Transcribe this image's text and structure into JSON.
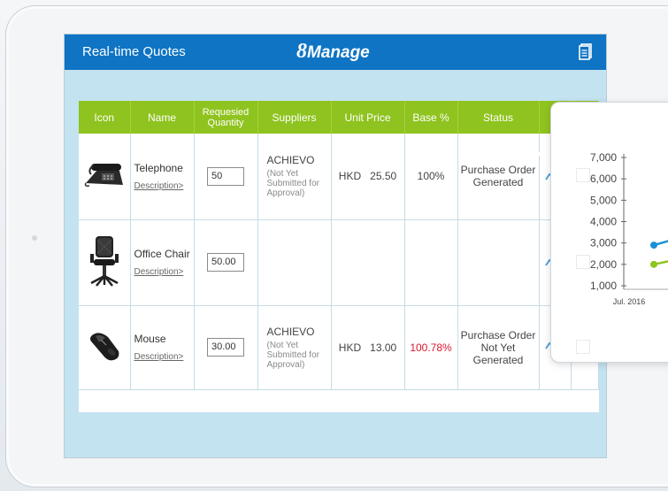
{
  "header": {
    "title": "Real-time Quotes",
    "logo_prefix": "8",
    "logo_text": "Manage"
  },
  "table": {
    "columns": [
      "Icon",
      "Name",
      "Requesied Quantity",
      "Suppliers",
      "Unit Price",
      "Base %",
      "Status"
    ],
    "rows": [
      {
        "name": "Telephone",
        "description_link": "Description>",
        "quantity": "50",
        "supplier": "ACHIEVO",
        "supplier_status": "(Not Yet Submitted for Approval)",
        "currency": "HKD",
        "unit_price": "25.50",
        "base_pct": "100%",
        "status": "Purchase Order Generated",
        "icon": "telephone-icon"
      },
      {
        "name": "Office Chair",
        "description_link": "Description>",
        "quantity": "50.00",
        "supplier": "",
        "supplier_status": "",
        "currency": "",
        "unit_price": "",
        "base_pct": "",
        "status": "",
        "icon": "office-chair-icon"
      },
      {
        "name": "Mouse",
        "description_link": "Description>",
        "quantity": "30.00",
        "supplier": "ACHIEVO",
        "supplier_status": "(Not Yet Submitted for Approval)",
        "currency": "HKD",
        "unit_price": "13.00",
        "base_pct": "100.78%",
        "status": "Purchase Order Not Yet Generated",
        "icon": "mouse-icon"
      }
    ]
  },
  "chart_data": {
    "type": "line",
    "y_ticks": [
      "7,000",
      "6,000",
      "5,000",
      "4,000",
      "3,000",
      "2,000",
      "1,000"
    ],
    "ylim": [
      1000,
      7000
    ],
    "x_tick": "Jul. 2016",
    "series": [
      {
        "color": "#1a91d6",
        "values": [
          2900,
          3300
        ]
      },
      {
        "color": "#8fc31f",
        "values": [
          2000,
          2300
        ]
      }
    ]
  },
  "colors": {
    "header": "#0e74c3",
    "table_header": "#8fc31f",
    "screen_bg": "#c4e3f0",
    "warning": "#d9172e"
  }
}
